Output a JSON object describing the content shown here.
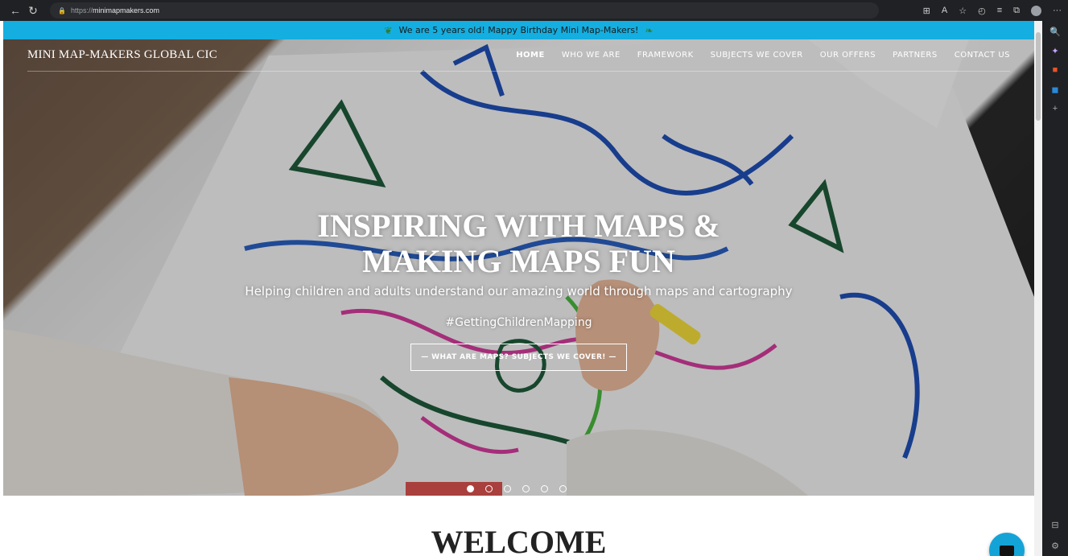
{
  "browser": {
    "url_prefix": "https://",
    "url_host": "minimapmakers.com",
    "back_icon": "←",
    "refresh_icon": "↻",
    "lock_icon": "🔒",
    "menu_icon": "···"
  },
  "announcement": {
    "text": "We are 5 years old! Mappy Birthday Mini Map-Makers!"
  },
  "site": {
    "logo": "MINI MAP-MAKERS GLOBAL CIC",
    "menu": [
      {
        "label": "HOME",
        "active": true
      },
      {
        "label": "WHO WE ARE"
      },
      {
        "label": "FRAMEWORK"
      },
      {
        "label": "SUBJECTS WE COVER"
      },
      {
        "label": "OUR OFFERS"
      },
      {
        "label": "PARTNERS"
      },
      {
        "label": "CONTACT US"
      }
    ]
  },
  "hero": {
    "title_line1": "INSPIRING WITH MAPS &",
    "title_line2": "MAKING MAPS FUN",
    "subtitle": "Helping children and adults understand our amazing world through maps and cartography",
    "hashtag": "#GettingChildrenMapping",
    "cta_label": "— WHAT ARE MAPS? SUBJECTS WE COVER! —",
    "slides_total": 6,
    "slide_active": 1
  },
  "welcome": {
    "heading": "WELCOME"
  },
  "colors": {
    "accent": "#14aee0",
    "chat": "#14a3d6"
  }
}
